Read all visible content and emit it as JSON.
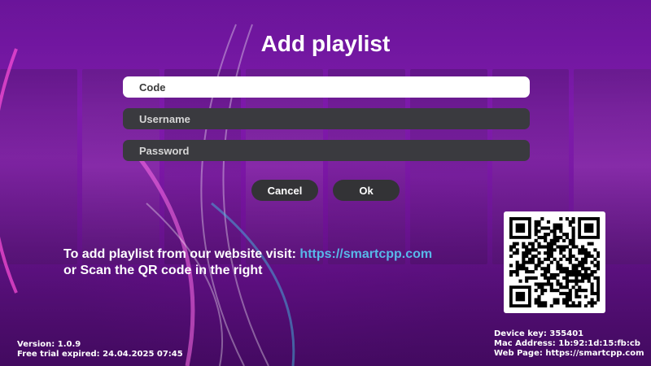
{
  "dialog": {
    "title": "Add playlist",
    "code_placeholder": "Code",
    "username_placeholder": "Username",
    "password_placeholder": "Password",
    "cancel_label": "Cancel",
    "ok_label": "Ok"
  },
  "hint": {
    "line1_text": "To add playlist from our website visit: ",
    "line1_link": "https://smartcpp.com",
    "line2_text": "or Scan the QR code in the right"
  },
  "footer_left": {
    "version": "Version: 1.0.9",
    "trial": "Free trial expired: 24.04.2025 07:45"
  },
  "footer_right": {
    "device_key": "Device key: 355401",
    "mac_address": "Mac Address: 1b:92:1d:15:fb:cb",
    "web_page": "Web Page: https://smartcpp.com"
  },
  "icons": {
    "qr": "qr-code"
  },
  "colors": {
    "accent_link": "#58b8e8",
    "button_bg": "#333336",
    "field_dark": "#3a3a3f",
    "background_purple": "#7a1aa8"
  }
}
